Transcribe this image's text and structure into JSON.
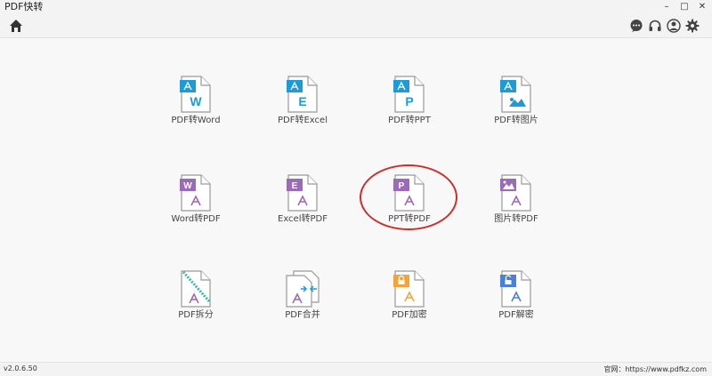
{
  "window": {
    "title": "PDF快转",
    "minimize": "–",
    "maximize": "□",
    "close": "✕"
  },
  "toolbar": {
    "home_icon": "home-icon",
    "right_icons": [
      "chat-icon",
      "headset-icon",
      "user-icon",
      "gear-icon"
    ]
  },
  "colors": {
    "blue": "#1e9ad6",
    "purple": "#9b6bb7",
    "orange": "#f2a33a",
    "blue_lock": "#4a80d8",
    "highlight": "#c9302c"
  },
  "tiles": [
    {
      "label": "PDF转Word",
      "badge": "W"
    },
    {
      "label": "PDF转Excel",
      "badge": "E"
    },
    {
      "label": "PDF转PPT",
      "badge": "P"
    },
    {
      "label": "PDF转图片",
      "badge": ""
    },
    {
      "label": "Word转PDF",
      "badge": "W"
    },
    {
      "label": "Excel转PDF",
      "badge": "E"
    },
    {
      "label": "PPT转PDF",
      "badge": "P"
    },
    {
      "label": "图片转PDF",
      "badge": ""
    },
    {
      "label": "PDF拆分",
      "badge": ""
    },
    {
      "label": "PDF合并",
      "badge": ""
    },
    {
      "label": "PDF加密",
      "badge": ""
    },
    {
      "label": "PDF解密",
      "badge": ""
    }
  ],
  "status": {
    "version": "v2.0.6.50",
    "site": "官网：https://www.pdfkz.com"
  }
}
